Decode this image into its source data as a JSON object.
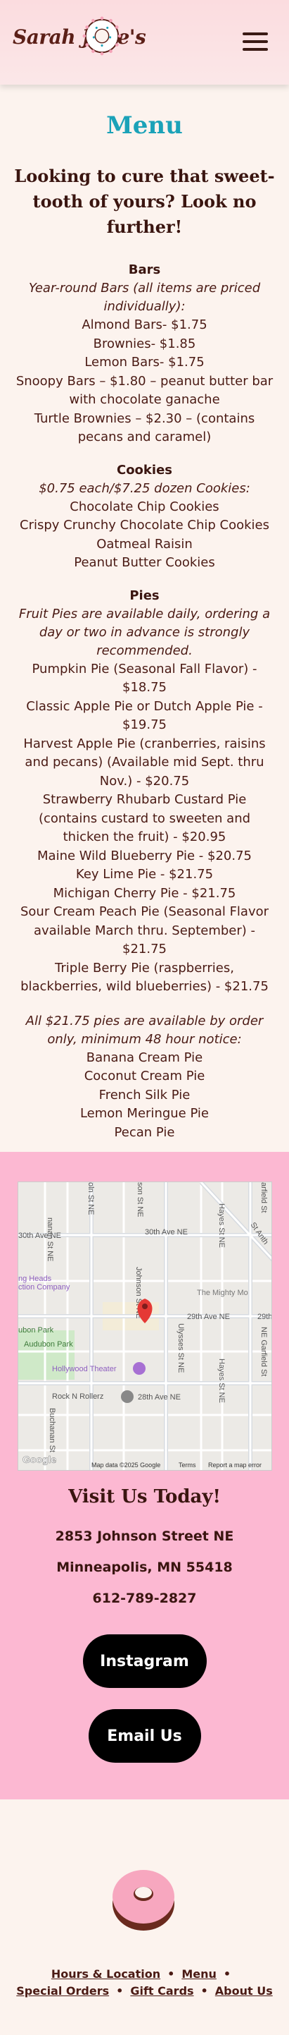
{
  "header": {
    "logo_text": "Sarah Jane's",
    "menu_icon": "hamburger-menu-icon"
  },
  "page": {
    "title": "Menu",
    "tagline": "Looking to cure that sweet-tooth of yours? Look no further!"
  },
  "sections": {
    "bars": {
      "title": "Bars",
      "note": "Year-round Bars (all items are priced individually):",
      "items": [
        "Almond Bars- $1.75",
        "Brownies- $1.85",
        "Lemon Bars- $1.75",
        "Snoopy Bars – $1.80 – peanut butter bar with chocolate ganache",
        "Turtle Brownies – $2.30 – (contains pecans and caramel)"
      ]
    },
    "cookies": {
      "title": "Cookies",
      "note": "$0.75 each/$7.25 dozen Cookies:",
      "items": [
        "Chocolate Chip Cookies",
        "Crispy Crunchy Chocolate Chip Cookies",
        "Oatmeal Raisin",
        "Peanut Butter Cookies"
      ]
    },
    "pies": {
      "title": "Pies",
      "note": "Fruit Pies are available daily, ordering a day or two in advance is strongly recommended.",
      "items": [
        "Pumpkin Pie (Seasonal Fall Flavor) - $18.75",
        "Classic Apple Pie or Dutch Apple Pie - $19.75",
        "Harvest Apple Pie (cranberries, raisins and pecans) (Available mid Sept. thru Nov.) - $20.75",
        "Strawberry Rhubarb Custard Pie (contains custard to sweeten and thicken the fruit) - $20.95",
        "Maine Wild Blueberry Pie - $20.75",
        "Key Lime Pie - $21.75",
        "Michigan Cherry Pie - $21.75",
        "Sour Cream Peach Pie (Seasonal Flavor available March thru. September) - $21.75",
        "Triple Berry Pie (raspberries, blackberries, wild blueberries) - $21.75"
      ],
      "note2": "All $21.75 pies are available by order only, minimum 48 hour notice:",
      "items2": [
        "Banana Cream Pie",
        "Coconut Cream Pie",
        "French Silk Pie",
        "Lemon Meringue Pie",
        "Pecan Pie"
      ]
    }
  },
  "map": {
    "streets": {
      "s30th_a": "30th Ave NE",
      "s30th_b": "30th Ave NE",
      "s29th": "29th Ave NE",
      "s29th_b": "29th",
      "s28th": "28th Ave NE",
      "buchanan_top": "nanan St NE",
      "lincoln": "oln St NE",
      "johnson_top": "son St NE",
      "johnson": "Johnson St NE",
      "hayes": "Hayes St NE",
      "hayes2": "Hayes St NE",
      "ulysses": "Ulysses St NE",
      "garfield": "NE Garfield St",
      "garfield_top": "arfield St",
      "st_anth": "St Anth",
      "buchanan": "Buchanan St"
    },
    "places": {
      "heads": "ng Heads",
      "heads2": "ction Company",
      "audubon": "ubon Park",
      "audubon2": "Audubon Park",
      "theater": "Hollywood Theater",
      "mighty": "The Mighty Mo",
      "rock": "Rock N Rollerz"
    },
    "attribution": {
      "google": "Google",
      "data": "Map data ©2025 Google",
      "terms": "Terms",
      "report": "Report a map error"
    },
    "colors": {
      "park": "#cfe9c8",
      "road": "#ffffff",
      "pin": "#e53935"
    }
  },
  "visit": {
    "title": "Visit Us Today!",
    "address": "2853 Johnson Street NE",
    "city": "Minneapolis, MN 55418",
    "phone": "612-789-2827",
    "instagram_label": "Instagram",
    "email_label": "Email Us"
  },
  "footer": {
    "links": [
      "Hours & Location",
      "Menu",
      "Special Orders",
      "Gift Cards",
      "About Us"
    ],
    "separator": "•"
  },
  "colors": {
    "accent": "#1ba2b8",
    "visit_bg": "#fcb8d2",
    "body_bg": "#fcf3ee",
    "text": "#4a1a14"
  }
}
